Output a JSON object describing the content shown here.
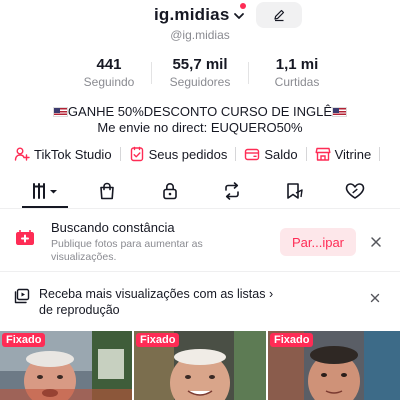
{
  "header": {
    "username": "ig.midias",
    "handle": "@ig.midias"
  },
  "stats": [
    {
      "value": "441",
      "label": "Seguindo"
    },
    {
      "value": "55,7 mil",
      "label": "Seguidores"
    },
    {
      "value": "1,1 mi",
      "label": "Curtidas"
    }
  ],
  "bio": {
    "line1": "GANHE 50%DESCONTO CURSO DE INGLÊ",
    "line2": "Me envie no direct: EUQUERO50%"
  },
  "shortcuts": [
    {
      "label": "TikTok Studio",
      "icon": "person-plus-icon"
    },
    {
      "label": "Seus pedidos",
      "icon": "order-check-icon"
    },
    {
      "label": "Saldo",
      "icon": "wallet-icon"
    },
    {
      "label": "Vitrine",
      "icon": "storefront-icon"
    }
  ],
  "tabs": [
    {
      "name": "videos-grid",
      "icon": "grid-icon"
    },
    {
      "name": "shop",
      "icon": "shopping-bag-icon"
    },
    {
      "name": "private",
      "icon": "lock-icon"
    },
    {
      "name": "reposts",
      "icon": "repost-icon"
    },
    {
      "name": "favorites",
      "icon": "bookmark-icon"
    },
    {
      "name": "liked",
      "icon": "heart-icon"
    }
  ],
  "banner_consistency": {
    "title": "Buscando constância",
    "description": "Publique fotos para aumentar as visualizações.",
    "button": "Par...ipar"
  },
  "banner_playlist": {
    "text": "Receba mais visualizações com as listas  › de reprodução"
  },
  "videos": [
    {
      "badge": "Fixado"
    },
    {
      "badge": "Fixado"
    },
    {
      "badge": "Fixado"
    }
  ],
  "colors": {
    "accent": "#fe2c55",
    "text": "#161823",
    "muted": "#8a8b91"
  }
}
